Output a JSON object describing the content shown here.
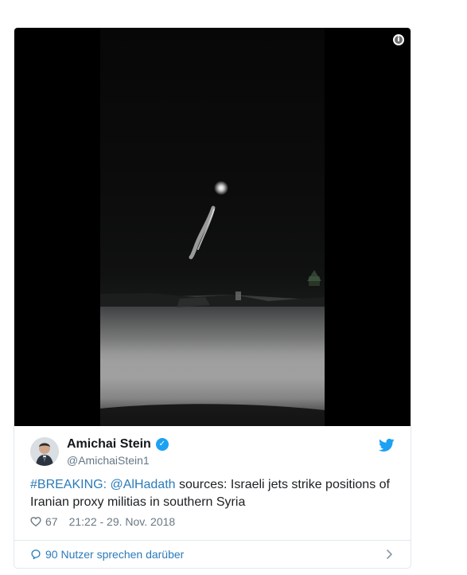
{
  "tweet": {
    "media": {
      "info_icon": "info-icon"
    },
    "author": {
      "name": "Amichai Stein",
      "handle": "@AmichaiStein1",
      "verified_icon": "verified-checkmark-icon",
      "brand_icon": "twitter-bird-icon"
    },
    "text": {
      "hashtag": "#BREAKING:",
      "mention": "@AlHadath",
      "body": "sources: Israeli jets strike positions of Iranian proxy militias in southern Syria"
    },
    "meta": {
      "like_count": "67",
      "timestamp": "21:22 - 29. Nov. 2018"
    },
    "conversation": {
      "label": "90 Nutzer sprechen darüber"
    }
  },
  "colors": {
    "link_blue": "#2b7bb9",
    "twitter_blue": "#1da1f2",
    "text_primary": "#1c2022",
    "text_muted": "#697882",
    "border": "#e1e8ed"
  }
}
